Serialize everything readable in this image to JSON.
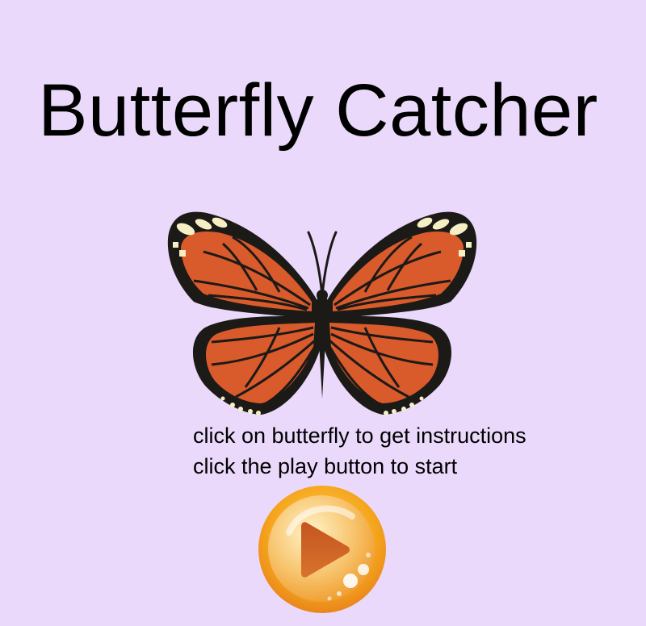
{
  "title": "Butterfly Catcher",
  "instructions": {
    "line1": "click on butterfly to get instructions",
    "line2": "click the play button to start"
  },
  "icons": {
    "butterfly": "monarch-butterfly-icon",
    "play": "play-icon"
  },
  "colors": {
    "background": "#ead9fb",
    "wing_orange": "#d95a2b",
    "wing_outline": "#1c1a17",
    "wing_spots": "#f6efc4",
    "play_gold": "#f2a21c",
    "play_arrow": "#cc5f22"
  }
}
